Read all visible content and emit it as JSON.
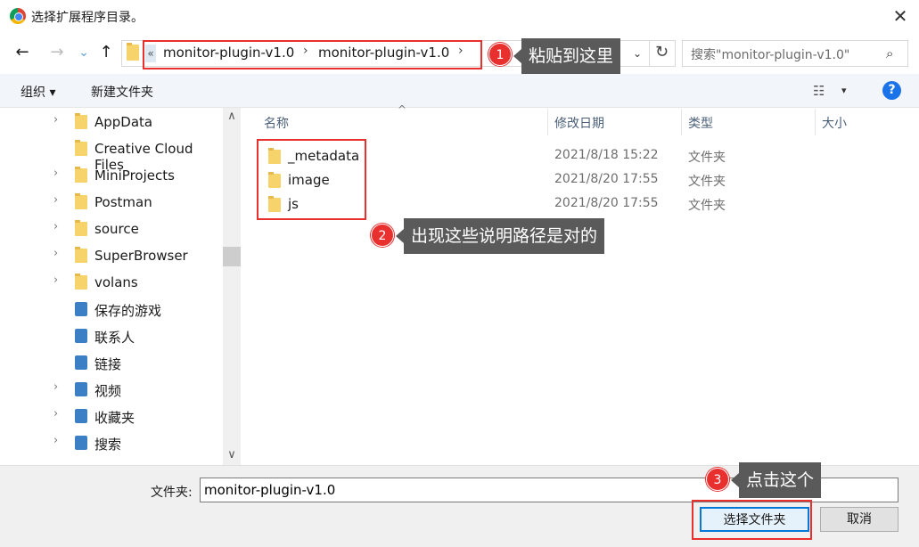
{
  "window": {
    "title": "选择扩展程序目录。",
    "close_glyph": "✕"
  },
  "nav": {
    "back": "←",
    "forward": "→",
    "recent": "⌄",
    "up": "↑"
  },
  "address": {
    "overflow": "«",
    "crumbs": [
      "monitor-plugin-v1.0",
      "monitor-plugin-v1.0"
    ],
    "sep": "›",
    "dropdown": "⌄",
    "refresh": "↻"
  },
  "search": {
    "placeholder": "搜索\"monitor-plugin-v1.0\"",
    "icon": "⌕"
  },
  "toolbar": {
    "organize": "组织 ▾",
    "new_folder": "新建文件夹",
    "view_icon": "☷",
    "view_dd": "▾",
    "help": "?"
  },
  "tree": [
    {
      "label": "AppData",
      "arrow": "›",
      "icon": "folder"
    },
    {
      "label": "Creative Cloud Files",
      "arrow": "",
      "icon": "folder"
    },
    {
      "label": "MiniProjects",
      "arrow": "›",
      "icon": "folder"
    },
    {
      "label": "Postman",
      "arrow": "›",
      "icon": "folder"
    },
    {
      "label": "source",
      "arrow": "›",
      "icon": "folder"
    },
    {
      "label": "SuperBrowser",
      "arrow": "›",
      "icon": "folder"
    },
    {
      "label": "volans",
      "arrow": "›",
      "icon": "folder"
    },
    {
      "label": "保存的游戏",
      "arrow": "",
      "icon": "special"
    },
    {
      "label": "联系人",
      "arrow": "",
      "icon": "special"
    },
    {
      "label": "链接",
      "arrow": "",
      "icon": "special"
    },
    {
      "label": "视频",
      "arrow": "›",
      "icon": "special"
    },
    {
      "label": "收藏夹",
      "arrow": "›",
      "icon": "special"
    },
    {
      "label": "搜索",
      "arrow": "›",
      "icon": "special"
    }
  ],
  "scroll": {
    "up": "∧",
    "down": "∨"
  },
  "columns": {
    "name": "名称",
    "date": "修改日期",
    "type": "类型",
    "size": "大小",
    "sort": "^"
  },
  "files": [
    {
      "name": "_metadata",
      "date": "2021/8/18 15:22",
      "type": "文件夹"
    },
    {
      "name": "image",
      "date": "2021/8/20 17:55",
      "type": "文件夹"
    },
    {
      "name": "js",
      "date": "2021/8/20 17:55",
      "type": "文件夹"
    }
  ],
  "bottom": {
    "folder_label": "文件夹:",
    "folder_value": "monitor-plugin-v1.0",
    "select": "选择文件夹",
    "cancel": "取消"
  },
  "annotations": [
    {
      "num": "1",
      "text": "粘贴到这里"
    },
    {
      "num": "2",
      "text": "出现这些说明路径是对的"
    },
    {
      "num": "3",
      "text": "点击这个"
    }
  ],
  "colors": {
    "annotation_red": "#e8302f",
    "callout_bg": "#5a5a5a",
    "accent": "#0078d7"
  }
}
